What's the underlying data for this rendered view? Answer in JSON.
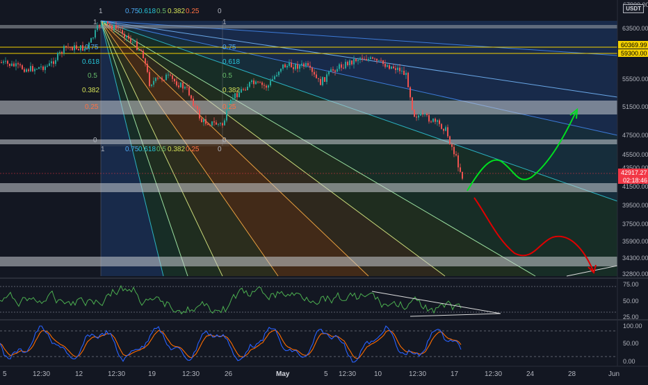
{
  "currency": "USDT",
  "price_axis": {
    "ticks": [
      "63500.00",
      "55500.00",
      "51500.00",
      "47500.00",
      "45500.00",
      "43500.00",
      "41500.00",
      "39500.00",
      "37500.00",
      "35900.00",
      "34300.00",
      "32800.00"
    ],
    "top_partial": "67900.00",
    "highlighted": [
      {
        "label": "60369.99",
        "color": "#f5d100",
        "text_color": "#000000"
      },
      {
        "label": "59300.00",
        "color": "#f5d100",
        "text_color": "#000000"
      },
      {
        "label": "42917.27",
        "color": "#f23645",
        "text_color": "#ffffff"
      },
      {
        "label": "02:18:46",
        "color": "#f23645",
        "text_color": "#ffffff"
      }
    ]
  },
  "rsi_axis": {
    "ticks": [
      "75.00",
      "50.00",
      "25.00"
    ]
  },
  "stoch_axis": {
    "ticks": [
      "100.00",
      "50.00",
      "0.00"
    ]
  },
  "time_axis": {
    "labels": [
      "5",
      "12:30",
      "12",
      "12:30",
      "19",
      "12:30",
      "26",
      "May",
      "5",
      "12:30",
      "10",
      "12:30",
      "17",
      "12:30",
      "24",
      "28",
      "Jun"
    ]
  },
  "fib_labels": {
    "top_row": [
      "1",
      "0.75",
      "0.618",
      "0.5",
      "0.382",
      "0.25",
      "0"
    ],
    "bottom_row": [
      "1",
      "0.75",
      "0.618",
      "0.5",
      "0.382",
      "0.25",
      "0"
    ],
    "left_col": [
      "1",
      "0.75",
      "0.618",
      "0.5",
      "0.382",
      "0.25",
      "0"
    ],
    "right_col": [
      "1",
      "0.75",
      "0.618",
      "0.5",
      "0.382",
      "0.25",
      "0"
    ]
  },
  "colors": {
    "background": "#131722",
    "up_candle": "#26a69a",
    "down_candle": "#ef5350",
    "rsi_line": "#4caf50",
    "stoch_k": "#2962ff",
    "stoch_d": "#ff6d00",
    "bull_arrow": "#00e020",
    "bear_arrow": "#e00000",
    "fib_yellow": "#f5d100"
  }
}
